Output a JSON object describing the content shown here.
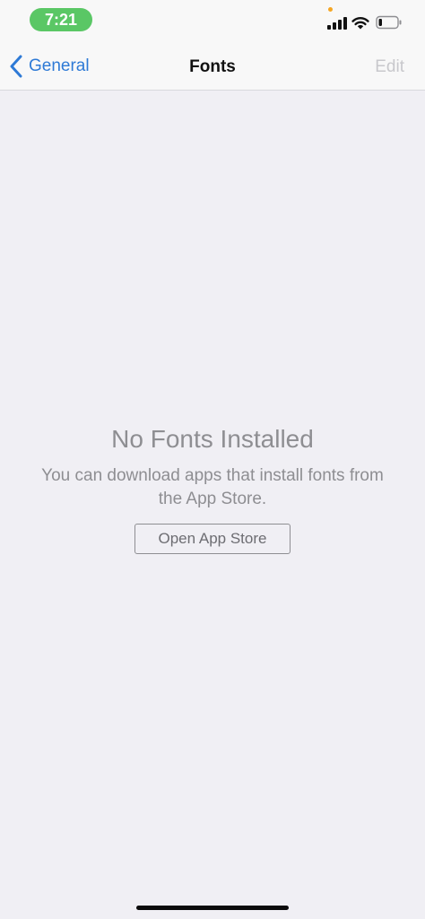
{
  "status_bar": {
    "time": "7:21",
    "icons": [
      "signal-icon",
      "wifi-icon",
      "battery-icon"
    ],
    "time_pill_color": "#5ac765",
    "mic_indicator_color": "#f5a623"
  },
  "nav": {
    "back_label": "General",
    "title": "Fonts",
    "edit_label": "Edit",
    "accent_color": "#2e7ad6"
  },
  "empty_state": {
    "title": "No Fonts Installed",
    "message": "You can download apps that install fonts from the App Store.",
    "button_label": "Open App Store"
  }
}
